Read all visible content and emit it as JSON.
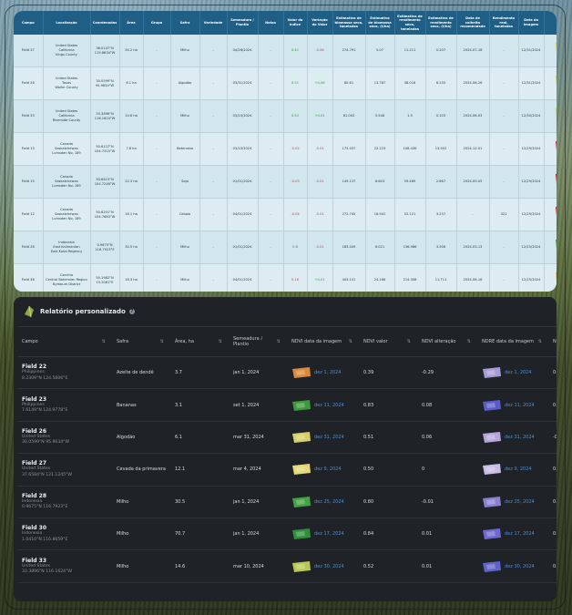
{
  "top_table": {
    "headers": [
      "Campo",
      "Localização",
      "Coordenadas",
      "Área",
      "Grupo",
      "Safra",
      "Variedade",
      "Semeadura / Plantio",
      "Notas",
      "Valor do índice",
      "Variação do Valor",
      "Estimativa de biomassa seca, toneladas",
      "Estimativa de biomassa seca, (t/ha)",
      "Estimativa de rendimento seco, toneladas",
      "Estimativa de rendimento seco, (t/ha)",
      "Data de colheita recomendada",
      "Rendimento real, toneladas",
      "Data da imagem",
      "Anotação"
    ],
    "rows": [
      {
        "campo": "Field 37",
        "loc": [
          "United States",
          "California",
          "Kings County"
        ],
        "coord": [
          "36.0147°N",
          "119.8634°W"
        ],
        "area": "54.2 ha",
        "grupo": "-",
        "safra": "Milho",
        "variedade": "-",
        "semeadura": "04/26/2024",
        "notas": "-",
        "valor": "0.41",
        "variacao": "-0.06",
        "bio_t": "274.791",
        "bio_ha": "5.07",
        "rend_t": "11.211",
        "rend_ha": "0.207",
        "colheita": "2024-07-18",
        "real": "-",
        "data": "12/31/2024",
        "thumb": "thumb-yellow"
      },
      {
        "campo": "Field 26",
        "loc": [
          "United States",
          "Texas",
          "Waller County"
        ],
        "coord": [
          "30.0599°N",
          "95.9634°W"
        ],
        "area": "6.1 ha",
        "grupo": "-",
        "safra": "Algodão",
        "variedade": "-",
        "semeadura": "03/31/2024",
        "notas": "-",
        "valor": "0.51",
        "variacao": "+0.06",
        "bio_t": "80.61",
        "bio_ha": "13.787",
        "rend_t": "38.016",
        "rend_ha": "6.235",
        "colheita": "2024-08-26",
        "real": "-",
        "data": "12/31/2024",
        "thumb": "thumb-green-yellow"
      },
      {
        "campo": "Field 33",
        "loc": [
          "United States",
          "California",
          "Riverside County"
        ],
        "coord": [
          "33.3896°N",
          "116.1624°W"
        ],
        "area": "14.6 ha",
        "grupo": "-",
        "safra": "Milho",
        "variedade": "-",
        "semeadura": "03/10/2024",
        "notas": "-",
        "valor": "0.52",
        "variacao": "+0.01",
        "bio_t": "81.002",
        "bio_ha": "5.548",
        "rend_t": "1.5",
        "rend_ha": "0.103",
        "colheita": "2024-06-03",
        "real": "-",
        "data": "12/30/2024",
        "thumb": "thumb-green-yellow"
      },
      {
        "campo": "Field 13",
        "loc": [
          "Canada",
          "Saskatchewan",
          "Lumsden No. 189"
        ],
        "coord": [
          "50.6127°N",
          "104.7315°W"
        ],
        "area": "7.8 ha",
        "grupo": "-",
        "safra": "Beterraba",
        "variedade": "-",
        "semeadura": "03/10/2024",
        "notas": "-",
        "valor": "-0.02",
        "variacao": "-0.01",
        "bio_t": "175.037",
        "bio_ha": "22.223",
        "rend_t": "108.436",
        "rend_ha": "13.902",
        "colheita": "2024-12-01",
        "real": "-",
        "data": "12/29/2024",
        "thumb": "thumb-red"
      },
      {
        "campo": "Field 15",
        "loc": [
          "Canada",
          "Saskatchewan",
          "Lumsden No. 189"
        ],
        "coord": [
          "50.6415°N",
          "104.7246°W"
        ],
        "area": "22.3 ha",
        "grupo": "-",
        "safra": "Soja",
        "variedade": "-",
        "semeadura": "01/01/2024",
        "notas": "-",
        "valor": "-0.03",
        "variacao": "-0.01",
        "bio_t": "149.137",
        "bio_ha": "6.643",
        "rend_t": "59.469",
        "rend_ha": "2.667",
        "colheita": "2024-09-05",
        "real": "-",
        "data": "12/29/2024",
        "thumb": "thumb-red"
      },
      {
        "campo": "Field 12",
        "loc": [
          "Canada",
          "Saskatchewan",
          "Lumsden No. 189"
        ],
        "coord": [
          "50.6201°N",
          "104.7683°W"
        ],
        "area": "16.1 ha",
        "grupo": "-",
        "safra": "Cebola",
        "variedade": "-",
        "semeadura": "04/01/2024",
        "notas": "-",
        "valor": "-0.04",
        "variacao": "-0.01",
        "bio_t": "272.745",
        "bio_ha": "16.941",
        "rend_t": "52.121",
        "rend_ha": "3.237",
        "colheita": "-",
        "real": "321",
        "data": "12/29/2024",
        "thumb": "thumb-red"
      },
      {
        "campo": "Field 28",
        "loc": [
          "Indonesia",
          "East Kalimantan",
          "East Kutai Regency"
        ],
        "coord": [
          "0.9675°N",
          "116.7923°E"
        ],
        "area": "30.5 ha",
        "grupo": "-",
        "safra": "Milho",
        "variedade": "-",
        "semeadura": "01/01/2024",
        "notas": "-",
        "valor": "0.8",
        "variacao": "-0.01",
        "bio_t": "183.049",
        "bio_ha": "6.021",
        "rend_t": "136.986",
        "rend_ha": "3.506",
        "colheita": "2024-03-13",
        "real": "-",
        "data": "12/25/2024",
        "thumb": "thumb-green"
      },
      {
        "campo": "Field 36",
        "loc": [
          "Czechia",
          "Central Bohemian Region",
          "Nymburk District"
        ],
        "coord": [
          "50.1982°N",
          "15.2061°E"
        ],
        "area": "18.3 ha",
        "grupo": "-",
        "safra": "Milho",
        "variedade": "-",
        "semeadura": "04/01/2024",
        "notas": "-",
        "valor": "0.16",
        "variacao": "+0.01",
        "bio_t": "443.141",
        "bio_ha": "24.166",
        "rend_t": "214.308",
        "rend_ha": "11.711",
        "colheita": "2024-08-16",
        "real": "-",
        "data": "12/25/2024",
        "thumb": "thumb-orange"
      }
    ]
  },
  "report": {
    "title": "Relatório personalizado",
    "help_icon": "question-icon",
    "columns": [
      "Campo",
      "Safra",
      "Área, ha",
      "Semeadura / Plantio",
      "NDVI data da imagem",
      "NDVI valor",
      "NDVI alteração",
      "NDRE data da imagem",
      "NDRE valor"
    ],
    "rows": [
      {
        "name": "Field 22",
        "country": "Philippines",
        "coord": "8.2309°N 124.5806°E",
        "safra": "Azeite de dendê",
        "area": "3.7",
        "semeadura": "jan 1, 2024",
        "ndvi_date": "dez 1, 2024",
        "ndvi_val": "0.39",
        "ndvi_alt": "-0.29",
        "ndvi_alt_sign": "neg",
        "ndre_date": "dez 1, 2024",
        "ndre_val": "0.06",
        "ndvi_color": "#d98a3a",
        "ndre_color": "#a79bd6"
      },
      {
        "name": "Field 23",
        "country": "Philippines",
        "coord": "7.6149°N 124.9778°E",
        "safra": "Bananas",
        "area": "3.1",
        "semeadura": "set 1, 2024",
        "ndvi_date": "dez 11, 2024",
        "ndvi_val": "0.83",
        "ndvi_alt": "0.08",
        "ndvi_alt_sign": "pos",
        "ndre_date": "dez 11, 2024",
        "ndre_val": "0.46",
        "ndvi_color": "#3c9a3c",
        "ndre_color": "#5a5cc8"
      },
      {
        "name": "Field 26",
        "country": "United States",
        "coord": "30.0599°N 95.9634°W",
        "safra": "Algodão",
        "area": "6.1",
        "semeadura": "mar 31, 2024",
        "ndvi_date": "dez 31, 2024",
        "ndvi_val": "0.51",
        "ndvi_alt": "0.06",
        "ndvi_alt_sign": "pos",
        "ndre_date": "dez 31, 2024",
        "ndre_val": "-0.12",
        "ndvi_color": "#d7cf6a",
        "ndre_color": "#b7a6dc"
      },
      {
        "name": "Field 27",
        "country": "United States",
        "coord": "37.6584°N 121.1245°W",
        "safra": "Cevada da primavera",
        "area": "12.1",
        "semeadura": "mar 4, 2024",
        "ndvi_date": "dez 9, 2024",
        "ndvi_val": "0.50",
        "ndvi_alt": "0",
        "ndvi_alt_sign": "none",
        "ndre_date": "dez 9, 2024",
        "ndre_val": "0.01",
        "ndvi_color": "#e3d97a",
        "ndre_color": "#c8bde6"
      },
      {
        "name": "Field 28",
        "country": "Indonesia",
        "coord": "0.9675°N 116.7923°E",
        "safra": "Milho",
        "area": "30.5",
        "semeadura": "jan 1, 2024",
        "ndvi_date": "dez 25, 2024",
        "ndvi_val": "0.80",
        "ndvi_alt": "-0.01",
        "ndvi_alt_sign": "neg",
        "ndre_date": "dez 25, 2024",
        "ndre_val": "0.33",
        "ndvi_color": "#44a244",
        "ndre_color": "#8b7fd0"
      },
      {
        "name": "Field 30",
        "country": "Indonesia",
        "coord": "1.0410°N 116.8659°E",
        "safra": "Milho",
        "area": "70.7",
        "semeadura": "jan 1, 2024",
        "ndvi_date": "dez 17, 2024",
        "ndvi_val": "0.84",
        "ndvi_alt": "0.01",
        "ndvi_alt_sign": "pos",
        "ndre_date": "dez 17, 2024",
        "ndre_val": "0.33",
        "ndvi_color": "#2f8f3a",
        "ndre_color": "#6e6ad0"
      },
      {
        "name": "Field 33",
        "country": "United States",
        "coord": "33.3896°N 116.1624°W",
        "safra": "Milho",
        "area": "14.6",
        "semeadura": "mar 10, 2024",
        "ndvi_date": "dez 30, 2024",
        "ndvi_val": "0.52",
        "ndvi_alt": "0.01",
        "ndvi_alt_sign": "pos",
        "ndre_date": "dez 30, 2024",
        "ndre_val": "0.16",
        "ndvi_color": "#b9c755",
        "ndre_color": "#6063c8"
      }
    ]
  },
  "colors": {
    "header_blue": "#1f5f86",
    "dark_panel": "#1f2226",
    "negative": "#d23c3c",
    "positive": "#2e9a3a",
    "link": "#4f8fd6"
  }
}
